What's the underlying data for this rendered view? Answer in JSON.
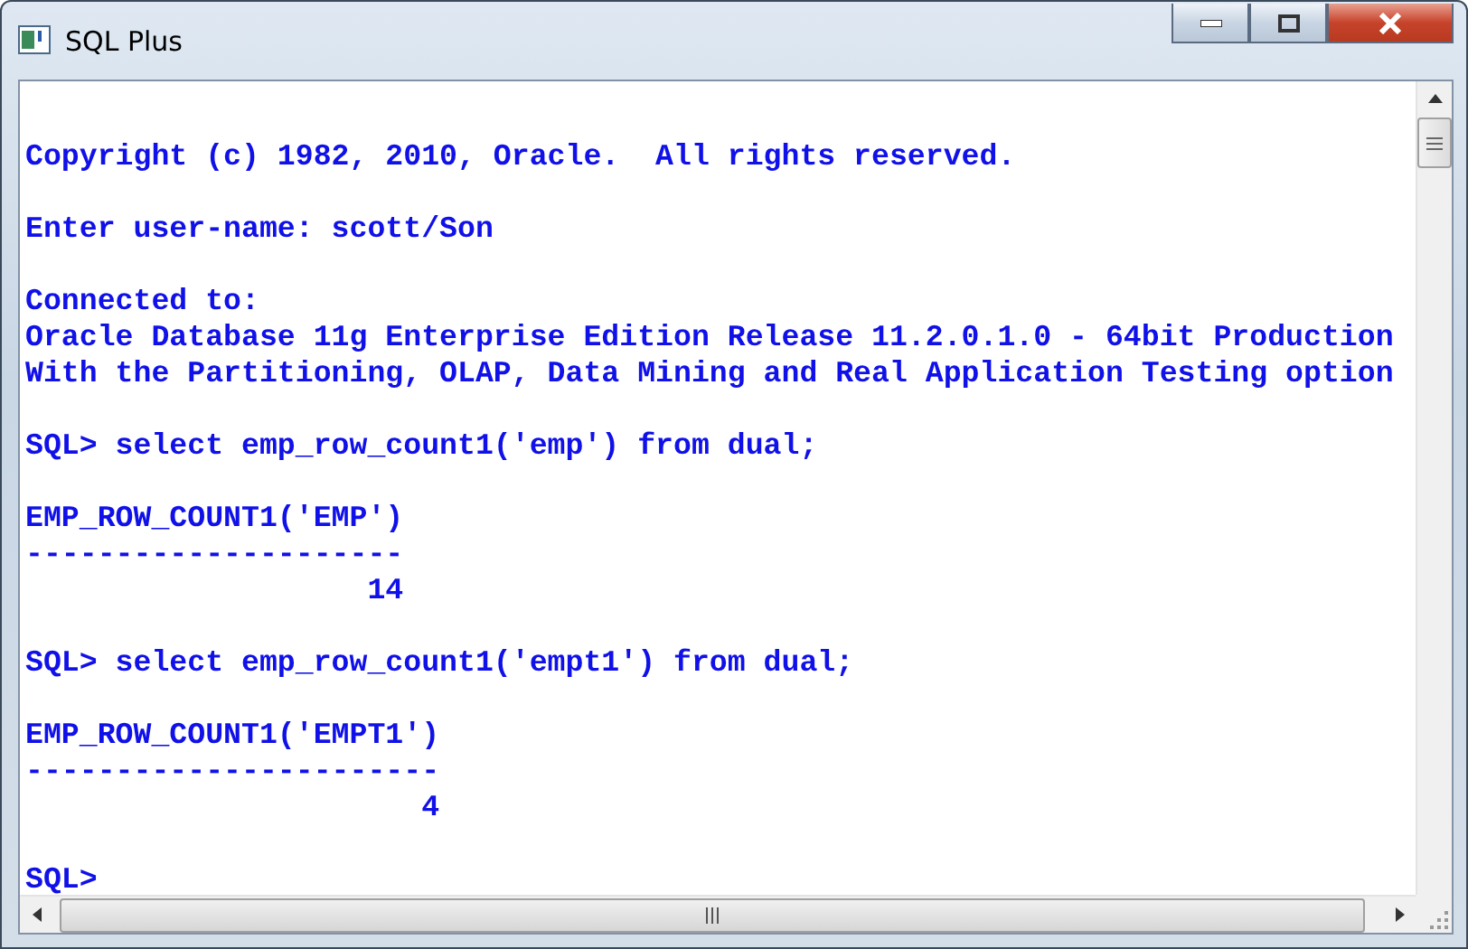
{
  "window": {
    "title": "SQL Plus"
  },
  "console_blocks": [
    {
      "lines": [
        "Copyright (c) 1982, 2010, Oracle.  All rights reserved."
      ]
    },
    {
      "lines": [
        "Enter user-name: scott/Son"
      ]
    },
    {
      "lines": [
        "Connected to:",
        "Oracle Database 11g Enterprise Edition Release 11.2.0.1.0 - 64bit Production",
        "With the Partitioning, OLAP, Data Mining and Real Application Testing option"
      ]
    },
    {
      "lines": [
        "SQL> select emp_row_count1('emp') from dual;"
      ]
    },
    {
      "lines": [
        "EMP_ROW_COUNT1('EMP')",
        "---------------------",
        "                   14"
      ]
    },
    {
      "lines": [
        "SQL> select emp_row_count1('empt1') from dual;"
      ]
    },
    {
      "lines": [
        "EMP_ROW_COUNT1('EMPT1')",
        "-----------------------",
        "                      4"
      ]
    },
    {
      "lines": [
        "SQL>"
      ]
    }
  ]
}
